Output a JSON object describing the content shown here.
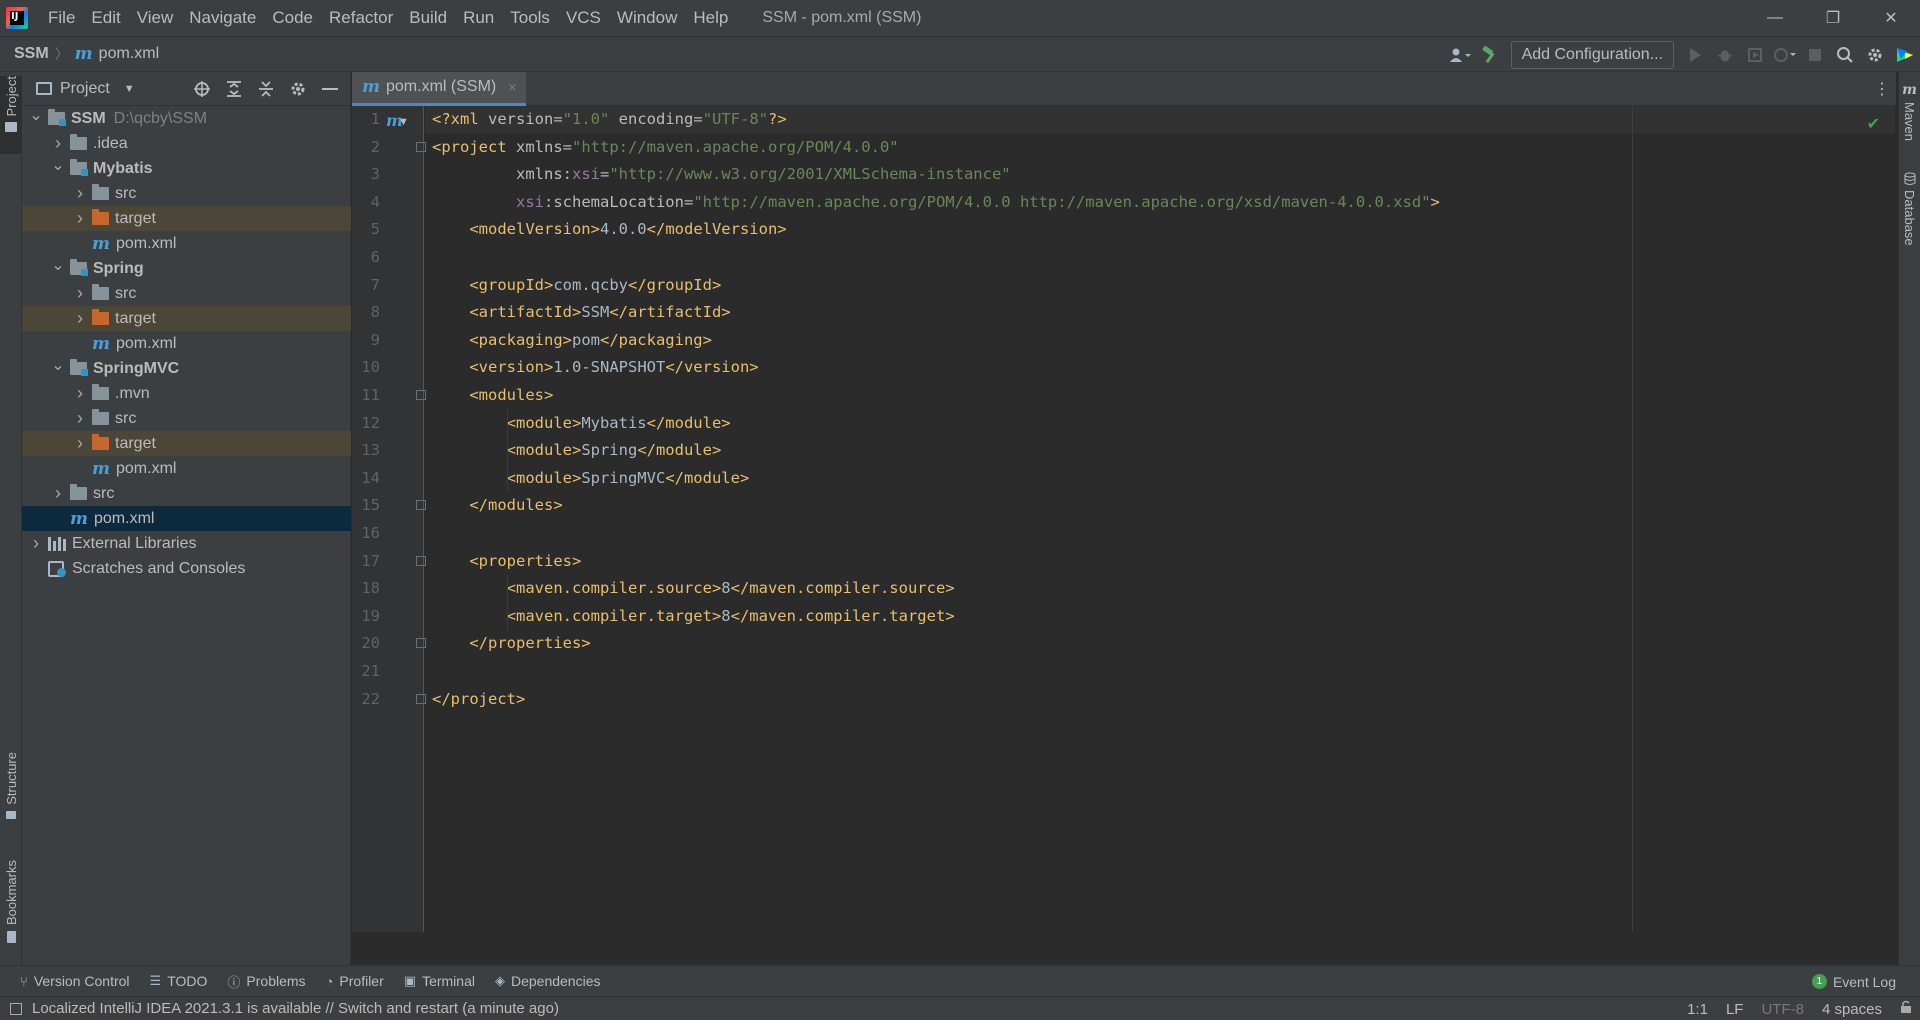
{
  "window": {
    "title": "SSM - pom.xml (SSM)",
    "menu": [
      "File",
      "Edit",
      "View",
      "Navigate",
      "Code",
      "Refactor",
      "Build",
      "Run",
      "Tools",
      "VCS",
      "Window",
      "Help"
    ],
    "minimize": "—",
    "restore": "❐",
    "close": "✕"
  },
  "navbar": {
    "crumb_root": "SSM",
    "crumb_sep": "〉",
    "crumb_file": "pom.xml",
    "file_icon_glyph": "m",
    "add_configuration": "Add Configuration...",
    "icons": [
      "user-icon",
      "hammer-icon",
      "run-icon",
      "debug-icon",
      "coverage-icon",
      "profile-icon",
      "stop-icon",
      "search-icon",
      "gear-icon",
      "jetbrains-icon"
    ]
  },
  "left_strip": {
    "project": "Project",
    "structure": "Structure",
    "bookmarks": "Bookmarks"
  },
  "right_strip": {
    "maven": "Maven",
    "database": "Database"
  },
  "project_panel": {
    "title": "Project",
    "tree": [
      {
        "label": "SSM",
        "extra": "D:\\qcby\\SSM",
        "kind": "module",
        "arrow": "open",
        "bold": true
      },
      {
        "label": ".idea",
        "kind": "folder",
        "arrow": "closed"
      },
      {
        "label": "Mybatis",
        "kind": "module",
        "arrow": "open",
        "bold": true
      },
      {
        "label": "src",
        "kind": "folder",
        "arrow": "closed"
      },
      {
        "label": "target",
        "kind": "excluded",
        "arrow": "closed"
      },
      {
        "label": "pom.xml",
        "kind": "maven"
      },
      {
        "label": "Spring",
        "kind": "module",
        "arrow": "open",
        "bold": true
      },
      {
        "label": "src",
        "kind": "folder",
        "arrow": "closed"
      },
      {
        "label": "target",
        "kind": "excluded",
        "arrow": "closed"
      },
      {
        "label": "pom.xml",
        "kind": "maven"
      },
      {
        "label": "SpringMVC",
        "kind": "module",
        "arrow": "open",
        "bold": true
      },
      {
        "label": ".mvn",
        "kind": "folder",
        "arrow": "closed"
      },
      {
        "label": "src",
        "kind": "folder",
        "arrow": "closed"
      },
      {
        "label": "target",
        "kind": "excluded",
        "arrow": "closed"
      },
      {
        "label": "pom.xml",
        "kind": "maven"
      },
      {
        "label": "src",
        "kind": "folder",
        "arrow": "closed"
      },
      {
        "label": "pom.xml",
        "kind": "maven",
        "selected": true
      },
      {
        "label": "External Libraries",
        "kind": "libs",
        "arrow": "closed"
      },
      {
        "label": "Scratches and Consoles",
        "kind": "scratch"
      }
    ]
  },
  "editor": {
    "tab_label": "pom.xml (SSM)",
    "tab_close": "×",
    "lines": [
      {
        "n": "1",
        "html": [
          [
            "pi",
            "<?xml "
          ],
          [
            "at",
            "version"
          ],
          [
            "tx",
            "="
          ],
          [
            "av",
            "\"1.0\""
          ],
          [
            "at",
            " encoding"
          ],
          [
            "tx",
            "="
          ],
          [
            "av",
            "\"UTF-8\""
          ],
          [
            "pi",
            "?>"
          ]
        ]
      },
      {
        "n": "2",
        "html": [
          [
            "tg",
            "<project "
          ],
          [
            "at",
            "xmlns"
          ],
          [
            "tx",
            "="
          ],
          [
            "av",
            "\"http://maven.apache.org/POM/4.0.0\""
          ]
        ]
      },
      {
        "n": "3",
        "html": [
          [
            "at",
            "         xmlns"
          ],
          [
            "tx",
            ":"
          ],
          [
            "ns",
            "xsi"
          ],
          [
            "tx",
            "="
          ],
          [
            "av",
            "\"http://www.w3.org/2001/XMLSchema-instance\""
          ]
        ]
      },
      {
        "n": "4",
        "html": [
          [
            "ns",
            "         xsi"
          ],
          [
            "tx",
            ":"
          ],
          [
            "at",
            "schemaLocation"
          ],
          [
            "tx",
            "="
          ],
          [
            "av",
            "\"http://maven.apache.org/POM/4.0.0 http://maven.apache.org/xsd/maven-4.0.0.xsd\""
          ],
          [
            "tg",
            ">"
          ]
        ]
      },
      {
        "n": "5",
        "html": [
          [
            "tg",
            "    <modelVersion>"
          ],
          [
            "tx",
            "4.0.0"
          ],
          [
            "tg",
            "</modelVersion>"
          ]
        ]
      },
      {
        "n": "6",
        "html": []
      },
      {
        "n": "7",
        "html": [
          [
            "tg",
            "    <groupId>"
          ],
          [
            "tx",
            "com.qcby"
          ],
          [
            "tg",
            "</groupId>"
          ]
        ]
      },
      {
        "n": "8",
        "html": [
          [
            "tg",
            "    <artifactId>"
          ],
          [
            "tx",
            "SSM"
          ],
          [
            "tg",
            "</artifactId>"
          ]
        ]
      },
      {
        "n": "9",
        "html": [
          [
            "tg",
            "    <packaging>"
          ],
          [
            "tx",
            "pom"
          ],
          [
            "tg",
            "</packaging>"
          ]
        ]
      },
      {
        "n": "10",
        "html": [
          [
            "tg",
            "    <version>"
          ],
          [
            "tx",
            "1.0-SNAPSHOT"
          ],
          [
            "tg",
            "</version>"
          ]
        ]
      },
      {
        "n": "11",
        "html": [
          [
            "tg",
            "    <modules>"
          ]
        ]
      },
      {
        "n": "12",
        "html": [
          [
            "tg",
            "        <module>"
          ],
          [
            "tx",
            "Mybatis"
          ],
          [
            "tg",
            "</module>"
          ]
        ]
      },
      {
        "n": "13",
        "html": [
          [
            "tg",
            "        <module>"
          ],
          [
            "tx",
            "Spring"
          ],
          [
            "tg",
            "</module>"
          ]
        ]
      },
      {
        "n": "14",
        "html": [
          [
            "tg",
            "        <module>"
          ],
          [
            "tx",
            "SpringMVC"
          ],
          [
            "tg",
            "</module>"
          ]
        ]
      },
      {
        "n": "15",
        "html": [
          [
            "tg",
            "    </modules>"
          ]
        ]
      },
      {
        "n": "16",
        "html": []
      },
      {
        "n": "17",
        "html": [
          [
            "tg",
            "    <properties>"
          ]
        ]
      },
      {
        "n": "18",
        "html": [
          [
            "tg",
            "        <maven.compiler.source>"
          ],
          [
            "tx",
            "8"
          ],
          [
            "tg",
            "</maven.compiler.source>"
          ]
        ]
      },
      {
        "n": "19",
        "html": [
          [
            "tg",
            "        <maven.compiler.target>"
          ],
          [
            "tx",
            "8"
          ],
          [
            "tg",
            "</maven.compiler.target>"
          ]
        ]
      },
      {
        "n": "20",
        "html": [
          [
            "tg",
            "    </properties>"
          ]
        ]
      },
      {
        "n": "21",
        "html": []
      },
      {
        "n": "22",
        "html": [
          [
            "tg",
            "</project>"
          ]
        ]
      }
    ],
    "fold_lines": [
      2,
      11,
      15,
      17,
      20,
      22
    ]
  },
  "bottom_tools": {
    "items": [
      {
        "label": "Version Control",
        "icon": "version-control-icon",
        "glyph": "⑂"
      },
      {
        "label": "TODO",
        "icon": "todo-icon",
        "glyph": "☰"
      },
      {
        "label": "Problems",
        "icon": "problems-icon",
        "glyph": "ⓘ"
      },
      {
        "label": "Profiler",
        "icon": "profiler-icon",
        "glyph": "◔"
      },
      {
        "label": "Terminal",
        "icon": "terminal-icon",
        "glyph": "▣"
      },
      {
        "label": "Dependencies",
        "icon": "dependencies-icon",
        "glyph": "◈"
      }
    ],
    "event_log": "Event Log",
    "event_count": "1"
  },
  "statusbar": {
    "message": "Localized IntelliJ IDEA 2021.3.1 is available // Switch and restart (a minute ago)",
    "position": "1:1",
    "line_sep": "LF",
    "encoding": "UTF-8",
    "indent": "4 spaces"
  },
  "colors": {
    "tag": "#e8bf6a",
    "attr": "#bababa",
    "value": "#6a8759",
    "namespace": "#9876aa",
    "text": "#a9b7c6",
    "selection": "#0d293e",
    "excluded": "#4c4638"
  }
}
